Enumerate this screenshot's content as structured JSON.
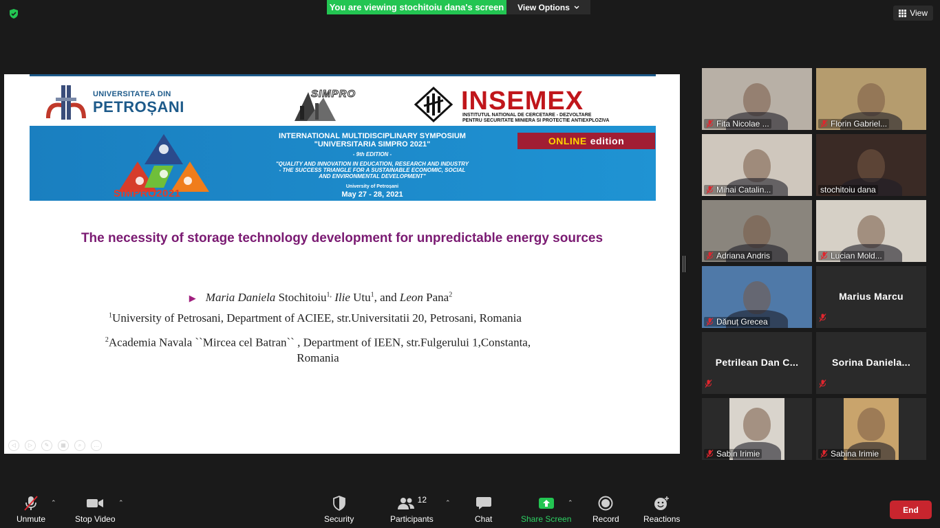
{
  "banner": {
    "viewing_text": "You are viewing stochitoiu dana's screen",
    "view_options_label": "View Options"
  },
  "top_right": {
    "view_label": "View"
  },
  "slide": {
    "univ_line1": "UNIVERSITATEA DIN",
    "univ_line2": "PETROȘANI",
    "simpro_logo_text": "SIMPRO",
    "insemex_title": "INSEMEX",
    "insemex_sub1": "INSTITUTUL NATIONAL DE CERCETARE - DEZVOLTARE",
    "insemex_sub2": "PENTRU SECURITATE MINIERA SI PROTECTIE ANTIEXPLOZIVA",
    "symposium_line1": "INTERNATIONAL MULTIDISCIPLINARY SYMPOSIUM",
    "symposium_line2": "\"UNIVERSITARIA SIMPRO 2021\"",
    "edition": "- 9th EDITION -",
    "theme_line1": "\"QUALITY AND INNOVATION IN EDUCATION, RESEARCH AND INDUSTRY",
    "theme_line2": "- THE SUCCESS TRIANGLE FOR A SUSTAINABLE ECONOMIC, SOCIAL",
    "theme_line3": "AND ENVIRONMENTAL DEVELOPMENT\"",
    "host": "University of Petroșani",
    "dates": "May 27 - 28, 2021",
    "online_word": "ONLINE",
    "online_edition": "edition",
    "simpro2021": "SIMPRO2021",
    "title": "The necessity of storage technology development for unpredictable energy sources",
    "author1_given": "Maria Daniela",
    "author1_family": "Stochitoiu",
    "author1_sup": "1,",
    "author2_given": "Ilie",
    "author2_family": "Utu",
    "author2_sup": "1",
    "and_text": ", and",
    "author3_given": "Leon",
    "author3_family": "Pana",
    "author3_sup": "2",
    "aff1_sup": "1",
    "aff1": "University of Petrosani, Department of ACIEE, str.Universitatii 20, Petrosani, Romania",
    "aff2_sup": "2",
    "aff2": "Academia Navala ``Mircea cel Batran`` , Department of IEEN, str.Fulgerului 1,Constanta, Romania"
  },
  "participants": [
    {
      "name": "Fita Nicolae ...",
      "video": true,
      "bg": "#b8b0a6",
      "muted": true
    },
    {
      "name": "Florin Gabriel...",
      "video": true,
      "bg": "#b59c6e",
      "muted": true
    },
    {
      "name": "Mihai Catalin...",
      "video": true,
      "bg": "#cfc7bd",
      "muted": true
    },
    {
      "name": "stochitoiu dana",
      "video": true,
      "bg": "#3a2a25",
      "muted": false,
      "active": true
    },
    {
      "name": "Adriana Andris",
      "video": true,
      "bg": "#8a857d",
      "muted": true
    },
    {
      "name": "Lucian Mold...",
      "video": true,
      "bg": "#d6d0c6",
      "muted": true
    },
    {
      "name": "Dănuț Grecea",
      "video": true,
      "bg": "#4f79a8",
      "muted": true
    },
    {
      "name": "Marius Marcu",
      "video": false,
      "muted": true
    },
    {
      "name": "Petrilean  Dan  C...",
      "video": false,
      "muted": true
    },
    {
      "name": "Sorina  Daniela...",
      "video": false,
      "muted": true
    },
    {
      "name": "Sabin Irimie",
      "video": true,
      "bg": "#2a2a2a",
      "muted": true,
      "small": true
    },
    {
      "name": "Sabina Irimie",
      "video": true,
      "bg": "#2a2a2a",
      "muted": true,
      "small": true
    }
  ],
  "toolbar": {
    "unmute": "Unmute",
    "stop_video": "Stop Video",
    "security": "Security",
    "participants": "Participants",
    "participants_count": "12",
    "chat": "Chat",
    "share_screen": "Share Screen",
    "record": "Record",
    "reactions": "Reactions",
    "end": "End"
  },
  "colors": {
    "share_green": "#23c552",
    "end_red": "#c8252e",
    "active_speaker": "#d7e44a",
    "title_purple": "#7a1a72"
  }
}
